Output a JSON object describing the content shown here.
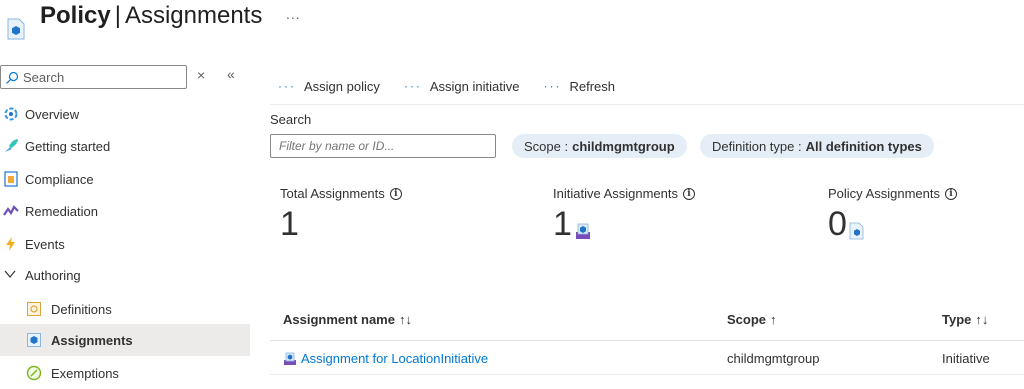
{
  "header": {
    "title_bold": "Policy",
    "title_sep": "|",
    "title_rest": "Assignments",
    "more": "...",
    "icon": "policy-icon"
  },
  "sidebar": {
    "search_placeholder": "Search",
    "close_glyph": "×",
    "collapse_glyph": "«",
    "items": [
      {
        "label": "Overview",
        "icon": "overview-icon"
      },
      {
        "label": "Getting started",
        "icon": "getting-started-icon"
      },
      {
        "label": "Compliance",
        "icon": "compliance-icon"
      },
      {
        "label": "Remediation",
        "icon": "remediation-icon"
      },
      {
        "label": "Events",
        "icon": "events-icon"
      },
      {
        "label": "Authoring",
        "icon": "chevron-down-icon"
      },
      {
        "label": "Definitions",
        "icon": "definitions-icon"
      },
      {
        "label": "Assignments",
        "icon": "assignments-icon",
        "active": true
      },
      {
        "label": "Exemptions",
        "icon": "exemptions-icon"
      }
    ]
  },
  "toolbar": {
    "dots": "···",
    "assign_policy": "Assign policy",
    "assign_initiative": "Assign initiative",
    "refresh": "Refresh"
  },
  "filters": {
    "search_label": "Search",
    "search_placeholder": "Filter by name or ID...",
    "scope_label": "Scope :",
    "scope_value": "childmgmtgroup",
    "deftype_label": "Definition type :",
    "deftype_value": "All definition types"
  },
  "stats": {
    "info_glyph": "i",
    "total": {
      "label": "Total Assignments",
      "value": "1"
    },
    "initiative": {
      "label": "Initiative Assignments",
      "value": "1"
    },
    "policy": {
      "label": "Policy Assignments",
      "value": "0"
    }
  },
  "table": {
    "headers": {
      "name": "Assignment name",
      "name_sort": "↑↓",
      "scope": "Scope",
      "scope_sort": "↑",
      "type": "Type",
      "type_sort": "↑↓"
    },
    "rows": [
      {
        "name": "Assignment for LocationInitiative",
        "scope": "childmgmtgroup",
        "type": "Initiative"
      }
    ]
  },
  "colors": {
    "accent": "#0078d4",
    "active_bg": "#edebe9",
    "pill_bg": "#e5eef7"
  }
}
